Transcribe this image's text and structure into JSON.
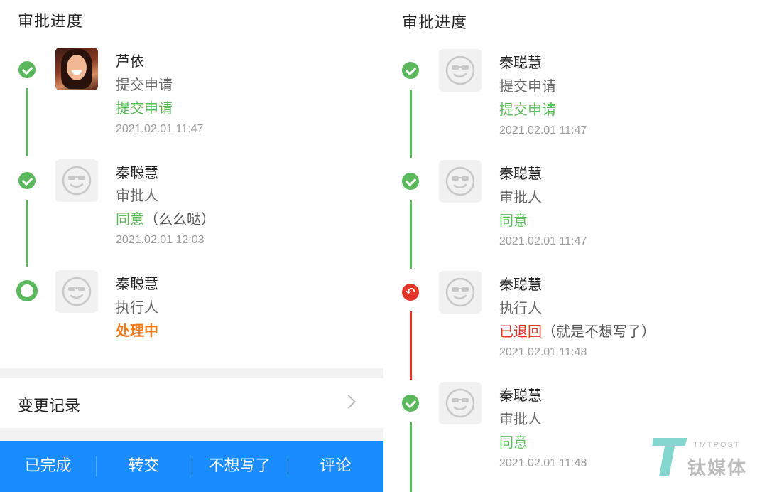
{
  "left": {
    "title": "审批进度",
    "steps": [
      {
        "name": "芦依",
        "role": "提交申请",
        "status": "提交申请",
        "note": "",
        "time": "2021.02.01 11:47"
      },
      {
        "name": "秦聪慧",
        "role": "审批人",
        "status": "同意",
        "note": "（么么哒）",
        "time": "2021.02.01 12:03"
      },
      {
        "name": "秦聪慧",
        "role": "执行人",
        "status": "处理中",
        "note": "",
        "time": ""
      }
    ],
    "change_record": "变更记录",
    "actions": [
      "已完成",
      "转交",
      "不想写了",
      "评论"
    ]
  },
  "right": {
    "title": "审批进度",
    "steps": [
      {
        "name": "秦聪慧",
        "role": "提交申请",
        "status": "提交申请",
        "note": "",
        "time": "2021.02.01 11:47"
      },
      {
        "name": "秦聪慧",
        "role": "审批人",
        "status": "同意",
        "note": "",
        "time": "2021.02.01 11:47"
      },
      {
        "name": "秦聪慧",
        "role": "执行人",
        "status": "已退回",
        "note": "（就是不想写了）",
        "time": "2021.02.01 11:48"
      },
      {
        "name": "秦聪慧",
        "role": "审批人",
        "status": "同意",
        "note": "",
        "time": "2021.02.01 11:48"
      }
    ]
  },
  "watermark": {
    "brand": "TMTPOST",
    "text": "钛媒体"
  },
  "colors": {
    "green": "#5cb85c",
    "orange": "#f07a1c",
    "red": "#e2352a",
    "blue": "#1a8cff"
  },
  "icons": {
    "done": "check-icon",
    "current": "ring-icon",
    "returned": "undo-arrow-icon",
    "more": "chevron-right-icon",
    "placeholder_avatar": "smiley-sunglasses-icon"
  }
}
